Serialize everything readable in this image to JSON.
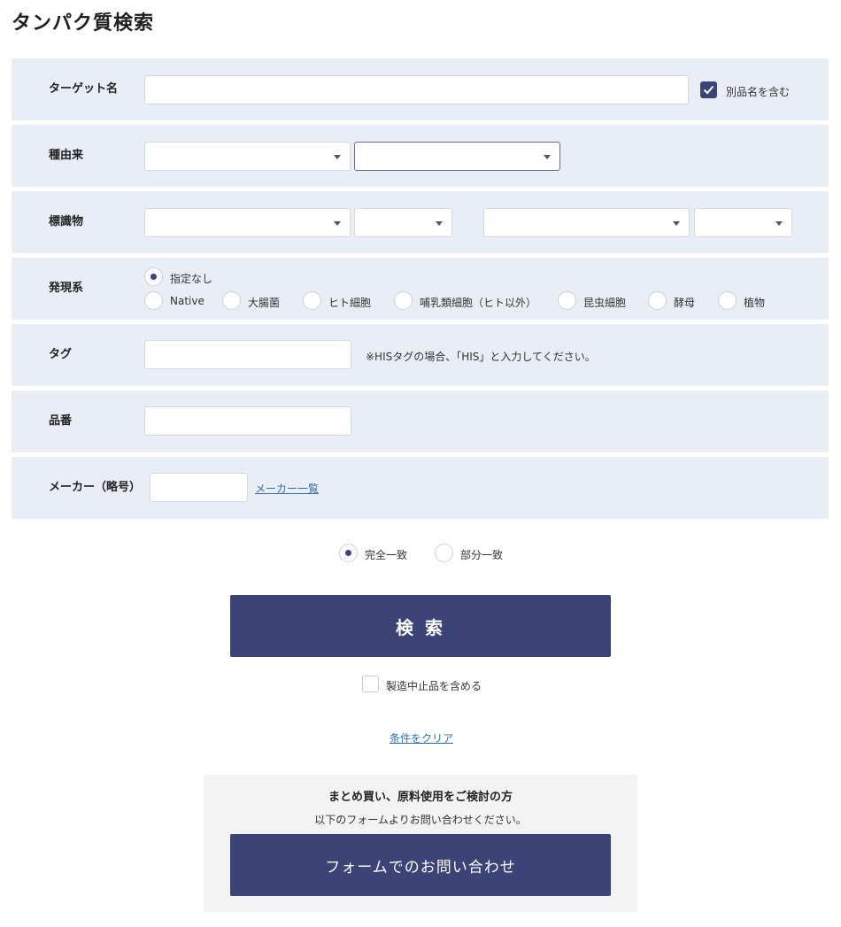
{
  "page": {
    "title": "タンパク質検索"
  },
  "target": {
    "label": "ターゲット名",
    "value": "",
    "alias_label": "別品名を含む",
    "alias_checked": true
  },
  "species": {
    "label": "種由来",
    "select1": "",
    "select2": ""
  },
  "label_row": {
    "label": "標識物",
    "select1": "",
    "select2": "",
    "select3": "",
    "select4": ""
  },
  "expression": {
    "label": "発現系",
    "selected": "指定なし",
    "options": [
      "指定なし",
      "Native",
      "大腸菌",
      "ヒト細胞",
      "哺乳類細胞（ヒト以外）",
      "昆虫細胞",
      "酵母",
      "植物"
    ]
  },
  "tag": {
    "label": "タグ",
    "value": "",
    "note": "※HISタグの場合、「HIS」と入力してください。"
  },
  "product_no": {
    "label": "品番",
    "value": ""
  },
  "maker": {
    "label": "メーカー（略号）",
    "value": "",
    "list_link": "メーカー一覧"
  },
  "match": {
    "exact": "完全一致",
    "partial": "部分一致",
    "selected": "完全一致"
  },
  "search": {
    "button": "検 索"
  },
  "discontinued": {
    "label": "製造中止品を含める",
    "checked": false
  },
  "clear": {
    "link": "条件をクリア"
  },
  "bulk": {
    "title": "まとめ買い、原料使用をご検討の方",
    "subtitle": "以下のフォームよりお問い合わせください。",
    "button": "フォームでのお問い合わせ"
  },
  "colors": {
    "accent": "#3b4377",
    "row_bg": "#e9eef6",
    "link": "#2f6fb6"
  }
}
